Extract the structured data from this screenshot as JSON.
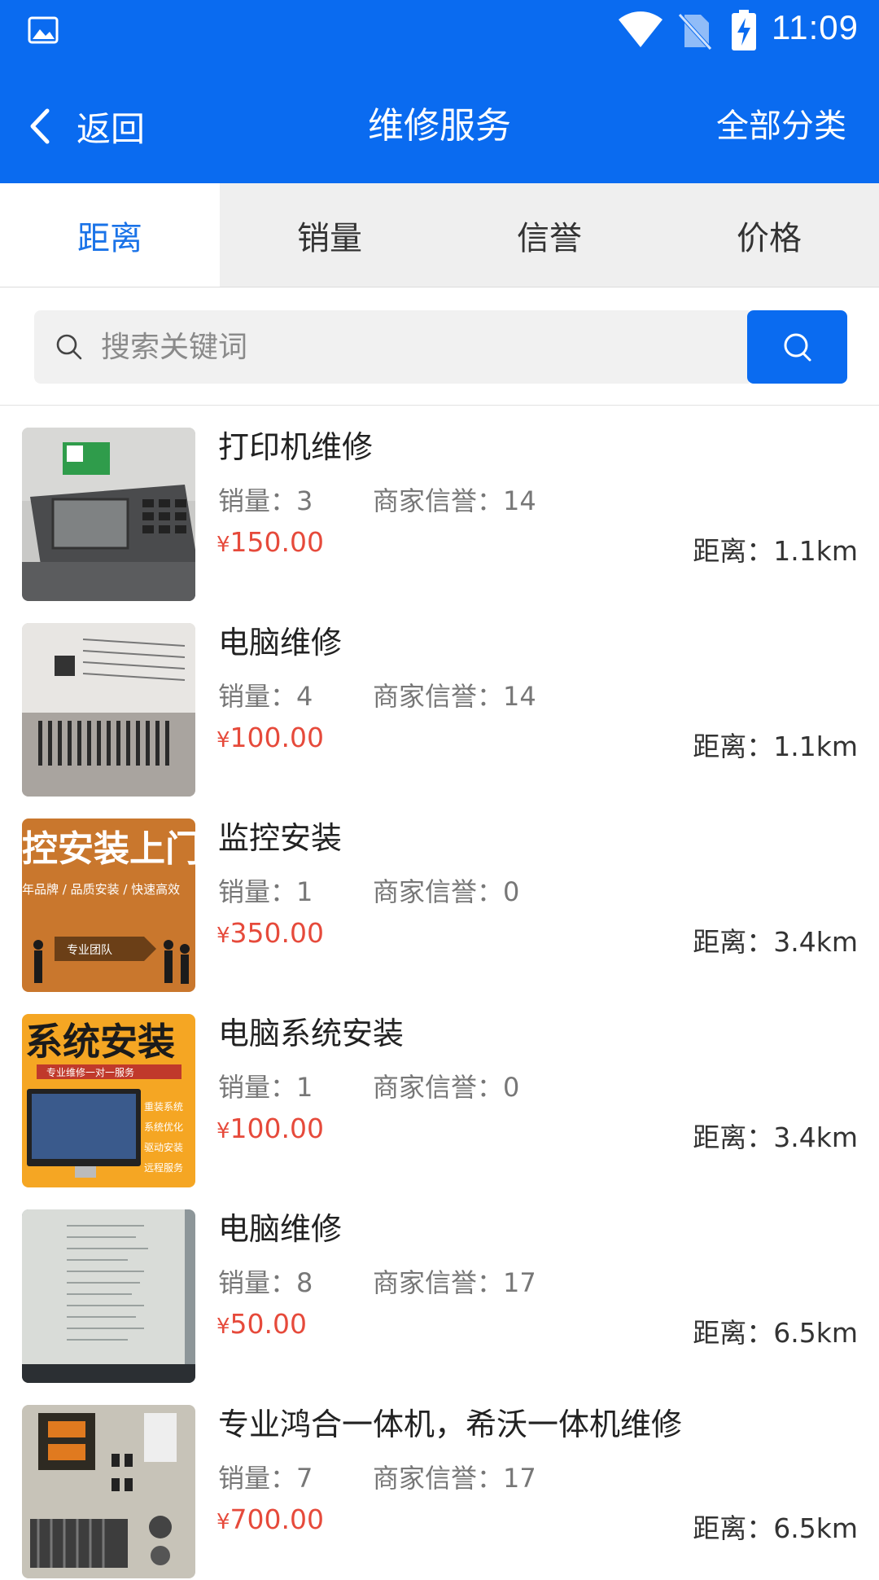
{
  "status_bar": {
    "time": "11:09",
    "icons": [
      "image-icon",
      "wifi-icon",
      "no-sim-icon",
      "battery-charging-icon"
    ]
  },
  "header": {
    "back_label": "返回",
    "title": "维修服务",
    "all_categories": "全部分类"
  },
  "tabs": [
    {
      "label": "距离",
      "active": true
    },
    {
      "label": "销量",
      "active": false
    },
    {
      "label": "信誉",
      "active": false
    },
    {
      "label": "价格",
      "active": false
    }
  ],
  "search": {
    "placeholder": "搜索关键词"
  },
  "colors": {
    "primary": "#0a6bf0",
    "active_tab_text": "#1a73e8",
    "price": "#e64a3b"
  },
  "items": [
    {
      "title": "打印机维修",
      "sales": "销量：3",
      "credit": "商家信誉：14",
      "currency": "¥",
      "price": "150.00",
      "distance": "距离：1.1km",
      "image": "printer-photo"
    },
    {
      "title": "电脑维修",
      "sales": "销量：4",
      "credit": "商家信誉：14",
      "currency": "¥",
      "price": "100.00",
      "distance": "距离：1.1km",
      "image": "computer-label-photo"
    },
    {
      "title": "监控安装",
      "sales": "销量：1",
      "credit": "商家信誉：0",
      "currency": "¥",
      "price": "350.00",
      "distance": "距离：3.4km",
      "image": "monitor-install-banner",
      "image_text": [
        "控安装上门",
        "年品牌 / 品质安装 / 快速高效",
        "专业团队"
      ]
    },
    {
      "title": "电脑系统安装",
      "sales": "销量：1",
      "credit": "商家信誉：0",
      "currency": "¥",
      "price": "100.00",
      "distance": "距离：3.4km",
      "image": "system-install-banner",
      "image_text": [
        "系统安装",
        "专业维修一对一服务",
        "重装系统",
        "系统优化",
        "驱动安装",
        "远程服务"
      ]
    },
    {
      "title": "电脑维修",
      "sales": "销量：8",
      "credit": "商家信誉：17",
      "currency": "¥",
      "price": "50.00",
      "distance": "距离：6.5km",
      "image": "screen-photo"
    },
    {
      "title": "专业鸿合一体机，希沃一体机维修",
      "sales": "销量：7",
      "credit": "商家信誉：17",
      "currency": "¥",
      "price": "700.00",
      "distance": "距离：6.5km",
      "image": "circuit-board-photo"
    }
  ]
}
